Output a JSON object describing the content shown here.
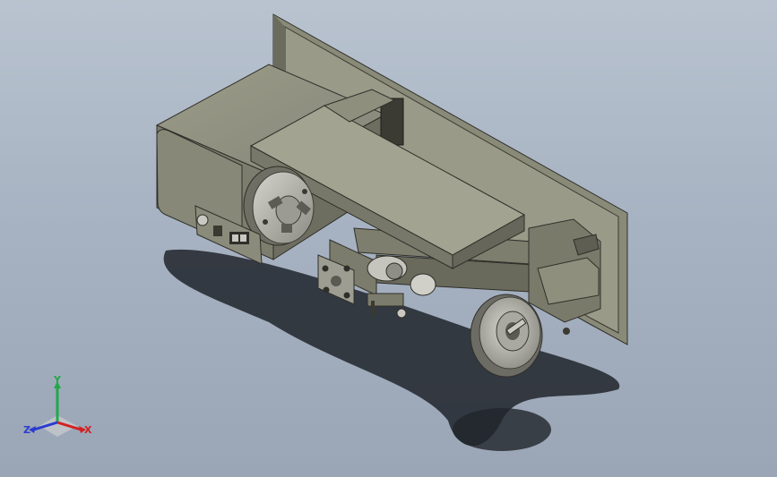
{
  "viewport": {
    "background_top": "#b9c3d0",
    "background_bottom": "#9aa6b6"
  },
  "model": {
    "body_color": "#8e8e7c",
    "dark_color": "#5a5a4e",
    "edge_color": "#2f2f2a",
    "chrome_color": "#c9c9c2"
  },
  "triad": {
    "x_label": "X",
    "y_label": "Y",
    "z_label": "Z",
    "x_color": "#d42020",
    "y_color": "#22a84a",
    "z_color": "#2b3bd0"
  }
}
